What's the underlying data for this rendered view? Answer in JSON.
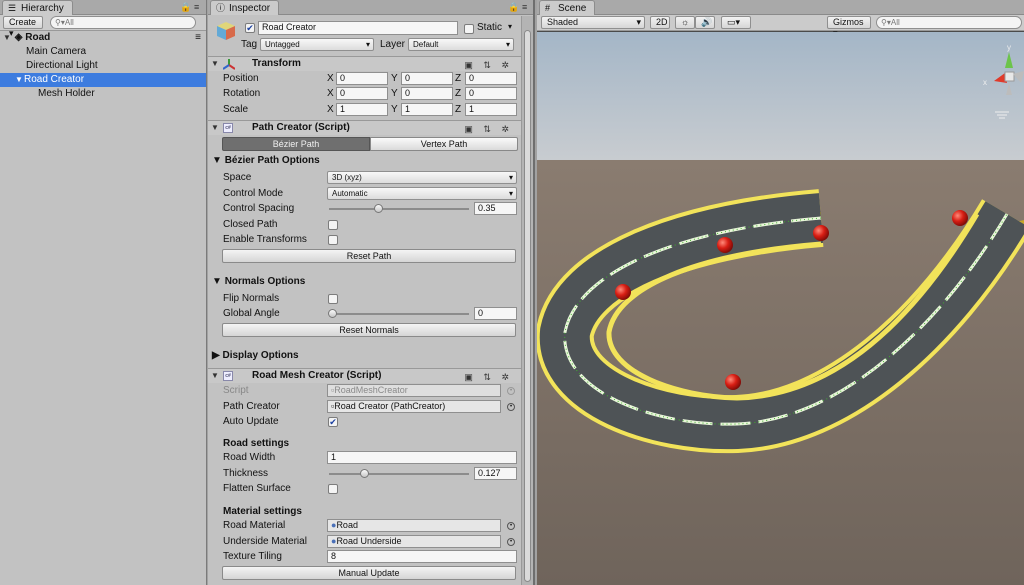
{
  "hierarchy": {
    "tab": "Hierarchy",
    "create_label": "Create",
    "search_placeholder": "All",
    "scene_name": "Road",
    "items": [
      {
        "label": "Main Camera",
        "indent": 1
      },
      {
        "label": "Directional Light",
        "indent": 1
      },
      {
        "label": "Road Creator",
        "indent": 1,
        "selected": true
      },
      {
        "label": "Mesh Holder",
        "indent": 2
      }
    ]
  },
  "inspector": {
    "tab": "Inspector",
    "object_name": "Road Creator",
    "static_label": "Static",
    "tag_label": "Tag",
    "tag_value": "Untagged",
    "layer_label": "Layer",
    "layer_value": "Default",
    "transform": {
      "title": "Transform",
      "position_label": "Position",
      "position": [
        "0",
        "0",
        "0"
      ],
      "rotation_label": "Rotation",
      "rotation": [
        "0",
        "0",
        "0"
      ],
      "scale_label": "Scale",
      "scale": [
        "1",
        "1",
        "1"
      ],
      "axes": [
        "X",
        "Y",
        "Z"
      ]
    },
    "path_creator": {
      "title": "Path Creator (Script)",
      "tab_bezier": "Bézier Path",
      "tab_vertex": "Vertex Path",
      "options_title": "Bézier Path Options",
      "space_label": "Space",
      "space_value": "3D (xyz)",
      "control_mode_label": "Control Mode",
      "control_mode_value": "Automatic",
      "control_spacing_label": "Control Spacing",
      "control_spacing_value": "0.35",
      "control_spacing_fraction": 0.35,
      "closed_path_label": "Closed Path",
      "enable_transforms_label": "Enable Transforms",
      "reset_path_label": "Reset Path",
      "normals_title": "Normals Options",
      "flip_normals_label": "Flip Normals",
      "global_angle_label": "Global Angle",
      "global_angle_value": "0",
      "global_angle_fraction": 0,
      "reset_normals_label": "Reset Normals",
      "display_options_title": "Display Options"
    },
    "road_mesh": {
      "title": "Road Mesh Creator (Script)",
      "script_label": "Script",
      "script_value": "RoadMeshCreator",
      "path_creator_label": "Path Creator",
      "path_creator_value": "Road Creator (PathCreator)",
      "auto_update_label": "Auto Update",
      "road_settings_title": "Road settings",
      "road_width_label": "Road Width",
      "road_width_value": "1",
      "thickness_label": "Thickness",
      "thickness_value": "0.127",
      "thickness_fraction": 0.25,
      "flatten_surface_label": "Flatten Surface",
      "material_settings_title": "Material settings",
      "road_material_label": "Road Material",
      "road_material_value": "Road",
      "underside_material_label": "Underside Material",
      "underside_material_value": "Road Underside",
      "texture_tiling_label": "Texture Tiling",
      "texture_tiling_value": "8",
      "manual_update_label": "Manual Update"
    }
  },
  "scene": {
    "tab": "Scene",
    "shading": "Shaded",
    "mode_2d": "2D",
    "gizmos": "Gizmos",
    "search_placeholder": "All",
    "gizmo_axes": {
      "y": "y",
      "x": "x"
    },
    "colors": {
      "sky": "#b8c3cf",
      "ground": "#766a60",
      "road": "#4e5356",
      "edge": "#f2e35a",
      "line": "#e9f6da",
      "anchor": "#d81e14"
    }
  }
}
